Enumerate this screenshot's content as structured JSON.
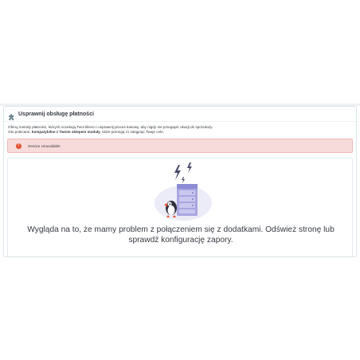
{
  "module": {
    "title": "Usprawnij obsługę płatności",
    "icon": "puzzle-icon",
    "description_line1": "Oferuj metody płatności, których oczekują Twoi klienci i usprawnij proces kasowy, aby nigdy nie przegapić okazji do sprzedaży.",
    "description_line2_prefix": "Oto polecane, ",
    "description_line2_bold": "kompatybilne z Twoim sklepem moduły",
    "description_line2_suffix": ", które pomogą Ci osiągnąć Twoje cele."
  },
  "alert": {
    "icon": "error-icon",
    "icon_glyph": "!",
    "text": "Service Unavailable",
    "color": "#f7dbdb"
  },
  "error_state": {
    "illustration": "server-lightning-illustration",
    "message": "Wygląda na to, że mamy problem z połączeniem się z dodatkami. Odśwież stronę lub sprawdź konfigurację zapory."
  },
  "colors": {
    "accent_purple": "#8e8bd6",
    "error_red": "#e2502f"
  }
}
